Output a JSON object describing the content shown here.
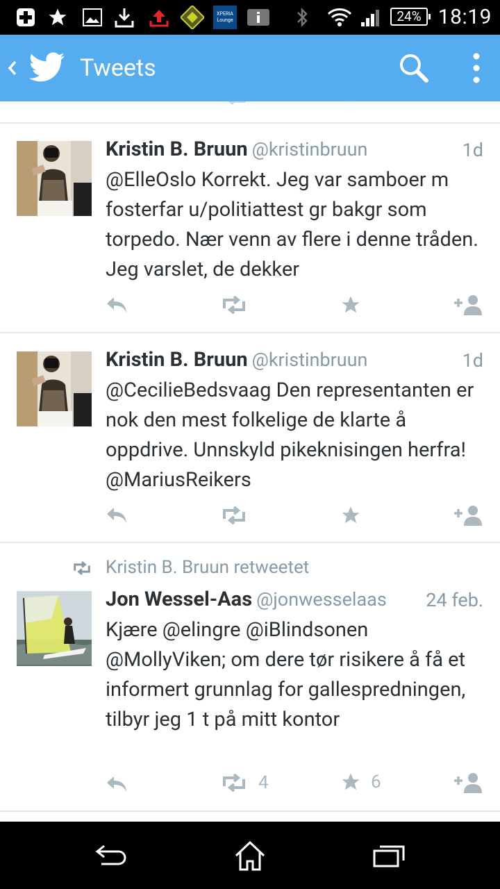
{
  "status_bar": {
    "time": "18:19",
    "battery": "24%",
    "left_icons": [
      "add-icon",
      "star-icon",
      "picture-icon",
      "download-icon",
      "upload-icon",
      "app-icon",
      "xperia-lounge-icon",
      "info-icon"
    ],
    "right_icons": [
      "bluetooth-icon",
      "wifi-icon",
      "signal-icon",
      "battery-icon"
    ],
    "xperia_text": "XPERIA Lounge"
  },
  "action_bar": {
    "title": "Tweets",
    "color": "#55acee"
  },
  "tweets": [
    {
      "name": "Kristin B. Bruun",
      "handle": "@kristinbruun",
      "time": "1d",
      "text": "@ElleOslo Korrekt. Jeg var samboer m fosterfar u/politiattest gr bakgr som torpedo. Nær venn av flere i denne tråden. Jeg varslet, de dekker",
      "retweets": "",
      "favorites": ""
    },
    {
      "name": "Kristin B. Bruun",
      "handle": "@kristinbruun",
      "time": "1d",
      "text": "@CecilieBedsvaag Den representanten er nok den mest folkelige de klarte å oppdrive. Unnskyld pikeknisingen herfra! @MariusReikers",
      "retweets": "",
      "favorites": ""
    },
    {
      "retweeted_by": "Kristin B. Bruun retweetet",
      "name": "Jon Wessel-Aas",
      "handle": "@jonwesselaas",
      "time": "24 feb.",
      "text": "Kjære @elingre @iBlindsonen @MollyViken; om dere tør risikere å få et informert grunnlag for gallespredningen, tilbyr jeg 1 t på mitt kontor",
      "retweets": "4",
      "favorites": "6"
    }
  ]
}
